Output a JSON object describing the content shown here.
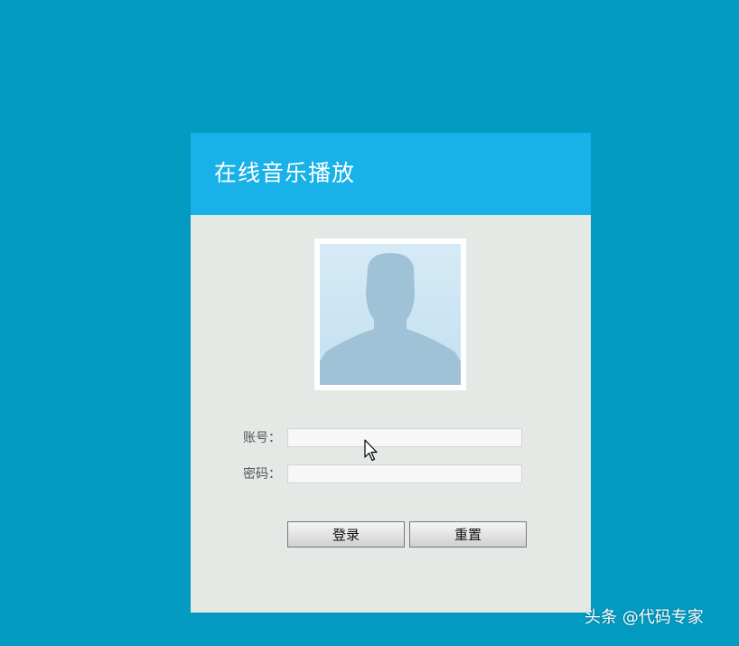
{
  "app": {
    "title": "在线音乐播放"
  },
  "avatar": {
    "icon": "user-silhouette-icon"
  },
  "form": {
    "account": {
      "label": "账号：",
      "value": "",
      "placeholder": ""
    },
    "password": {
      "label": "密码：",
      "value": "",
      "placeholder": ""
    },
    "login_label": "登录",
    "reset_label": "重置"
  },
  "watermark": {
    "text": "头条 @代码专家"
  },
  "colors": {
    "background": "#039bc1",
    "header": "#18b1e8",
    "panel": "#e5e9e6"
  }
}
